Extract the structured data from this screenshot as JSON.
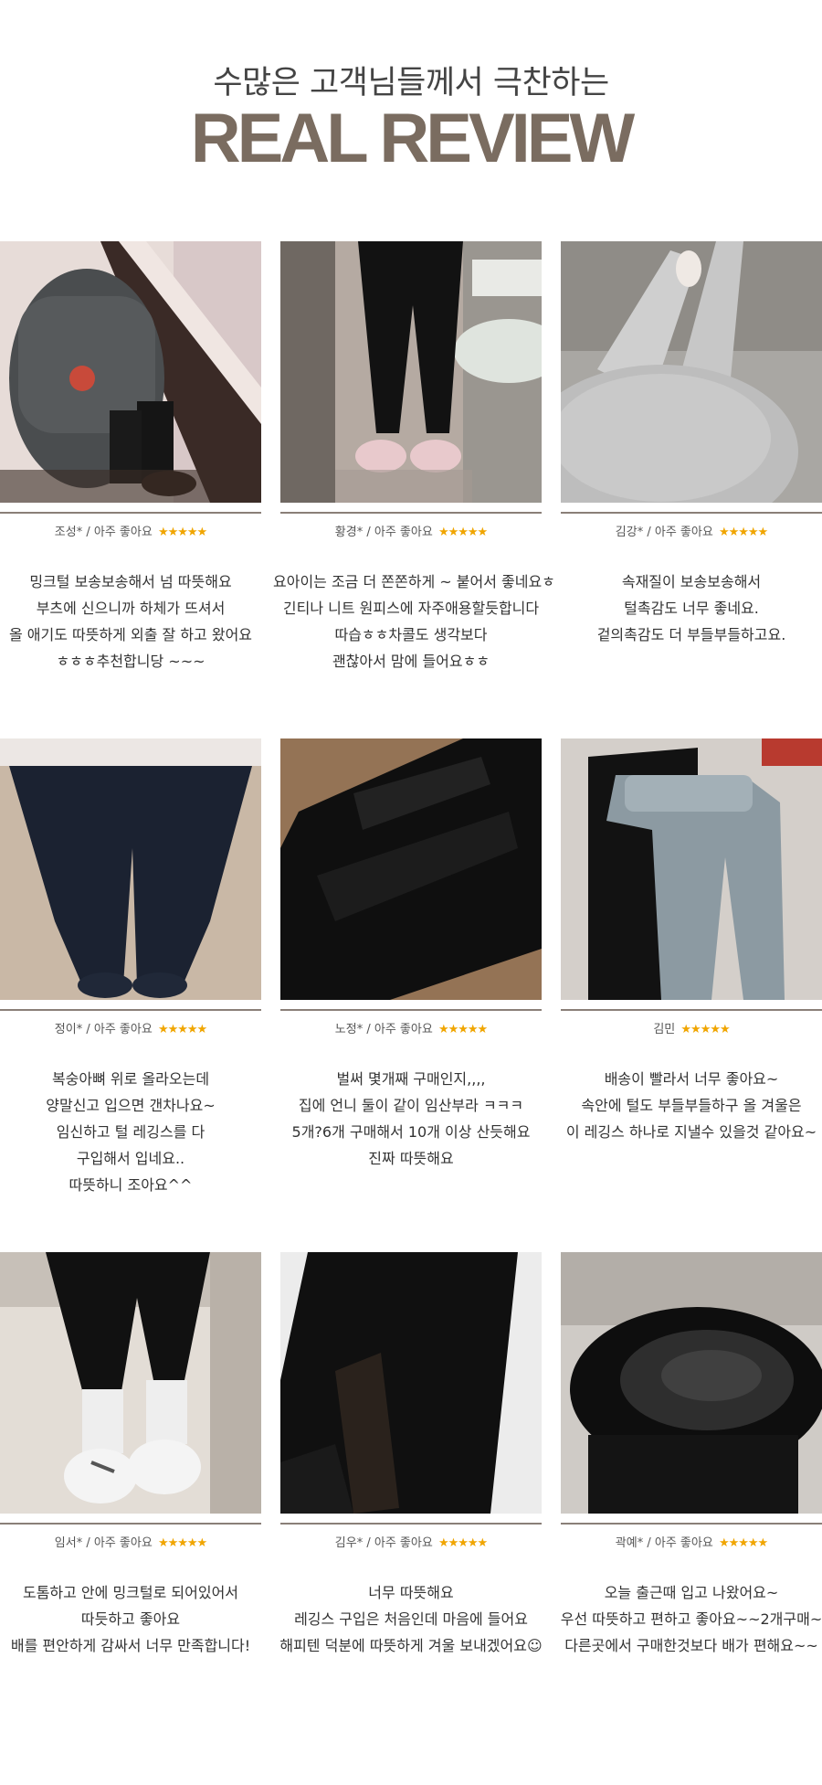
{
  "header": {
    "subtitle": "수많은 고객님들께서 극찬하는",
    "title": "REAL REVIEW"
  },
  "reviews": [
    {
      "name": "조성*",
      "rating_label": "아주 좋아요",
      "stars": "★★★★★",
      "photo": "woman-in-grey-coat-mirror-selfie",
      "lines": [
        "밍크털 보송보송해서 넘 따뜻해요",
        "부츠에 신으니까 하체가 뜨셔서",
        "올 애기도 따뜻하게 외출 잘 하고 왔어요",
        "ㅎㅎㅎ추천합니당 ~~~"
      ]
    },
    {
      "name": "황경*",
      "rating_label": "아주 좋아요",
      "stars": "★★★★★",
      "photo": "black-leggings-with-slippers",
      "lines": [
        "요아이는 조금 더 쫀쫀하게 ~ 붙어서 좋네요ㅎ",
        "긴티나 니트 원피스에 자주애용할듯합니다",
        "따습ㅎㅎ차콜도 생각보다",
        "괜찮아서 맘에 들어요ㅎㅎ"
      ]
    },
    {
      "name": "김강*",
      "rating_label": "아주 좋아요",
      "stars": "★★★★★",
      "photo": "grey-maternity-leggings-top-view",
      "lines": [
        "속재질이 보송보송해서",
        "털촉감도 너무 좋네요.",
        "겉의촉감도 더 부들부들하고요."
      ]
    },
    {
      "name": "정이*",
      "rating_label": "아주 좋아요",
      "stars": "★★★★★",
      "photo": "navy-leggings-on-wood-floor",
      "lines": [
        "복숭아뼈 위로 올라오는데",
        "양말신고 입으면 갠차나요~",
        "임신하고 털 레깅스를 다",
        "구입해서 입네요..",
        "따뜻하니 조아요^^"
      ]
    },
    {
      "name": "노정*",
      "rating_label": "아주 좋아요",
      "stars": "★★★★★",
      "photo": "folded-black-leggings",
      "lines": [
        "벌써 몇개째 구매인지,,,,",
        "집에 언니 둘이 같이 임산부라 ㅋㅋㅋ",
        "5개?6개 구매해서 10개 이상 산듯해요",
        "진짜 따뜻해요"
      ]
    },
    {
      "name": "김민",
      "rating_label": "",
      "stars": "★★★★★",
      "photo": "grey-and-black-leggings-laid-flat",
      "lines": [
        "배송이 빨라서 너무 좋아요~",
        "속안에 털도 부들부들하구 올 겨울은",
        "이 레깅스 하나로 지낼수 있을것 같아요~"
      ]
    },
    {
      "name": "임서*",
      "rating_label": "아주 좋아요",
      "stars": "★★★★★",
      "photo": "black-leggings-with-sneakers",
      "lines": [
        "도톰하고 안에 밍크털로 되어있어서",
        "따듯하고 좋아요",
        "배를 편안하게 감싸서 너무 만족합니다!"
      ]
    },
    {
      "name": "김우*",
      "rating_label": "아주 좋아요",
      "stars": "★★★★★",
      "photo": "leggings-cuff-fleece-lining",
      "lines": [
        "너무 따뜻해요",
        "레깅스 구입은 처음인데 마음에 들어요",
        "해피텐 덕분에 따뜻하게 겨울 보내겠어요☺"
      ]
    },
    {
      "name": "곽예*",
      "rating_label": "아주 좋아요",
      "stars": "★★★★★",
      "photo": "inside-out-fleece-leggings",
      "lines": [
        "오늘 출근때 입고 나왔어요~",
        "우선 따뜻하고 편하고 좋아요~~2개구매~",
        "다른곳에서 구매한것보다 배가 편해요~~"
      ]
    }
  ]
}
